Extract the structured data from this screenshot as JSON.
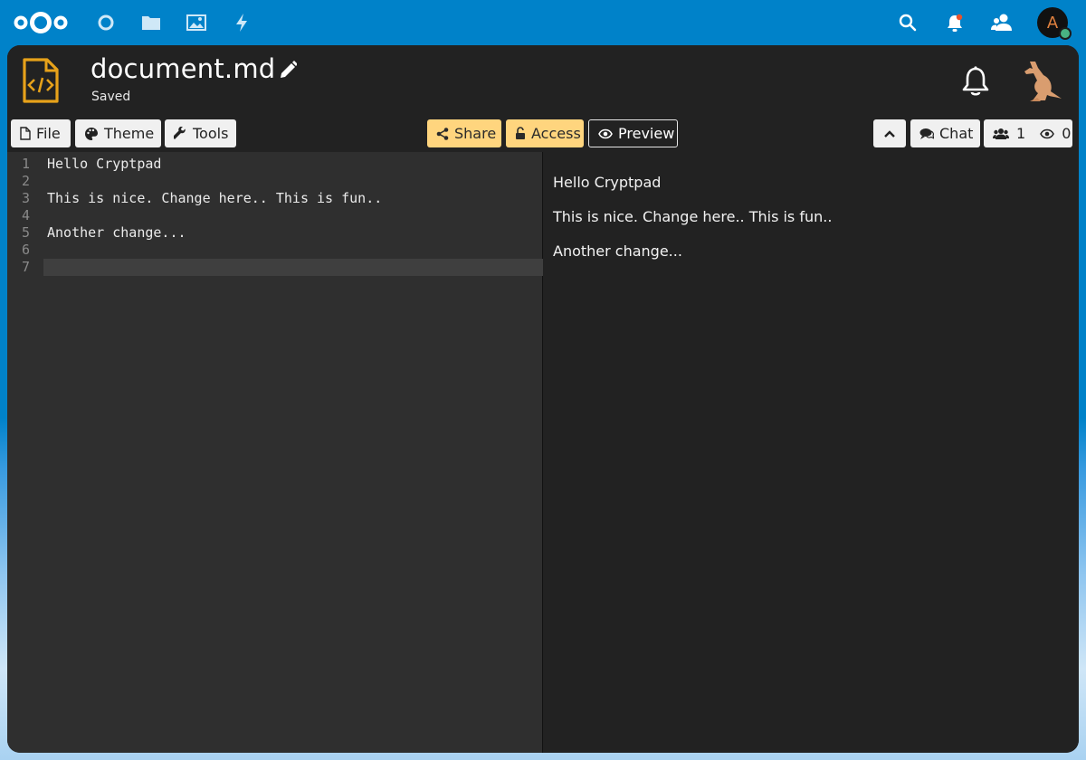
{
  "window": {
    "doc_title": "document.md",
    "save_status": "Saved",
    "avatar_initial": "A"
  },
  "nc_header": {
    "apps": [
      "dashboard-icon",
      "files-icon",
      "photos-icon",
      "activity-icon"
    ],
    "right_icons": [
      "search-icon",
      "notifications-icon",
      "contacts-icon"
    ]
  },
  "toolbar": {
    "file_label": "File",
    "theme_label": "Theme",
    "tools_label": "Tools",
    "share_label": "Share",
    "access_label": "Access",
    "preview_label": "Preview",
    "chat_label": "Chat",
    "users_count": "1",
    "viewers_count": "0"
  },
  "editor": {
    "line_numbers": [
      "1",
      "2",
      "3",
      "4",
      "5",
      "6",
      "7"
    ],
    "lines": [
      "Hello Cryptpad",
      "",
      "This is nice. Change here.. This is fun..",
      "",
      "Another change...",
      "",
      ""
    ],
    "active_line": 7
  },
  "preview": {
    "paragraphs": [
      "Hello Cryptpad",
      "This is nice. Change here.. This is fun..",
      "Another change..."
    ]
  },
  "colors": {
    "nc_blue": "#0082c9",
    "accent_yellow": "#ffd57e",
    "file_icon_orange": "#e7a21a"
  }
}
